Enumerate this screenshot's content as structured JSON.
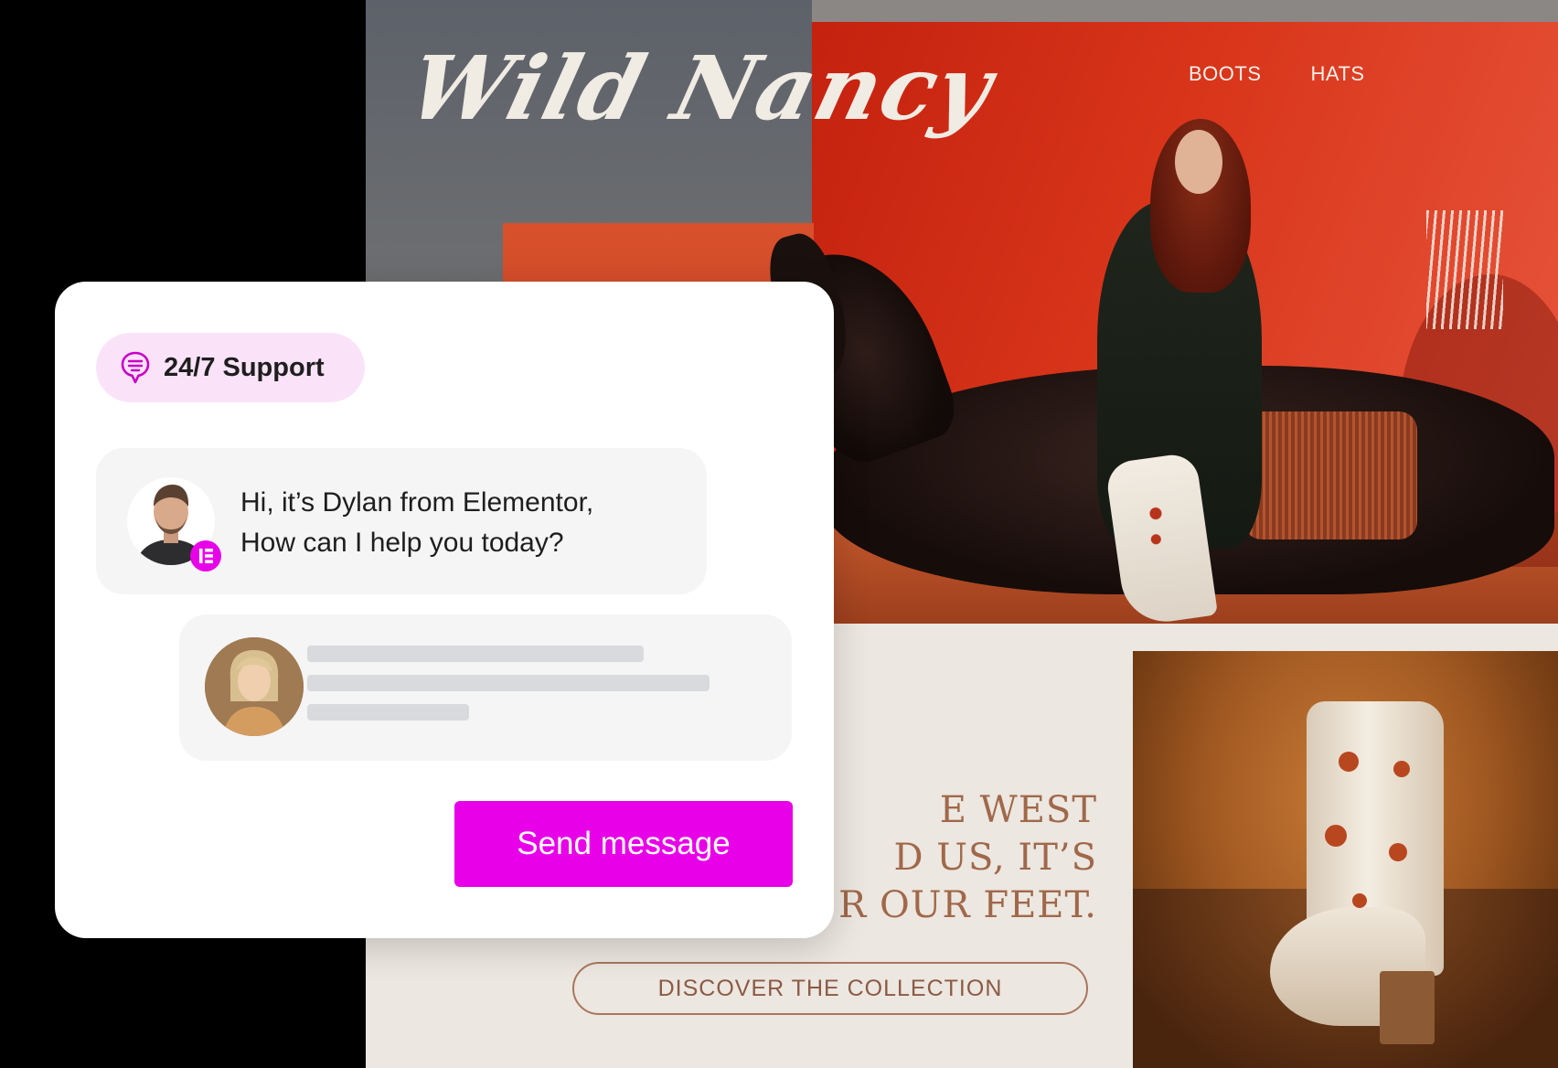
{
  "site": {
    "logo": "Wild Nancy",
    "nav": [
      "BOOTS",
      "HATS"
    ],
    "tagline_lines": [
      "E WEST",
      "D US, IT’S",
      "R OUR FEET."
    ],
    "cta": "DISCOVER THE COLLECTION"
  },
  "chat": {
    "badge_label": "24/7 Support",
    "badge_icon": "chat-bubble-icon",
    "agent_message_line1": "Hi, it’s Dylan from Elementor,",
    "agent_message_line2": "How can I help you today?",
    "agent_badge_icon": "elementor-logo-icon",
    "send_label": "Send message"
  },
  "colors": {
    "accent": "#e800e8",
    "badge_bg": "#fae3f9",
    "tagline": "#a0684a",
    "background": "#000000"
  }
}
